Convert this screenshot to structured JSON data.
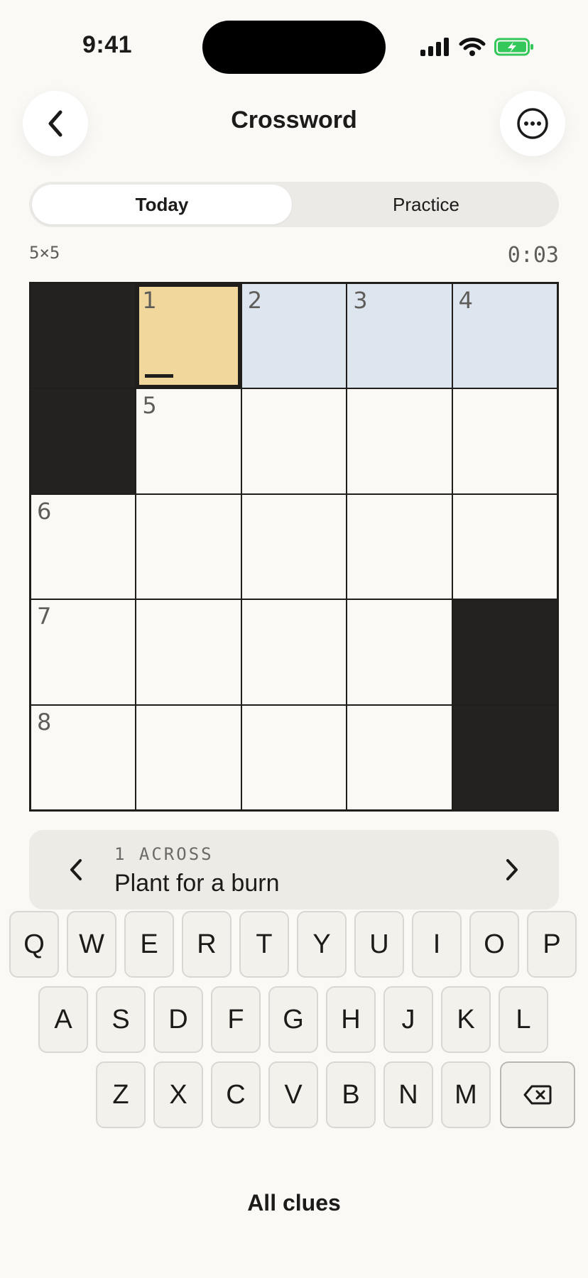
{
  "status": {
    "time": "9:41"
  },
  "header": {
    "title": "Crossword"
  },
  "tabs": [
    {
      "label": "Today",
      "active": true
    },
    {
      "label": "Practice",
      "active": false
    }
  ],
  "puzzle": {
    "size_label": "5×5",
    "timer": "0:03",
    "grid": [
      [
        "#",
        "1",
        "2",
        "3",
        "4"
      ],
      [
        "#",
        "5",
        "",
        "",
        ""
      ],
      [
        "6",
        "",
        "",
        "",
        ""
      ],
      [
        "7",
        "",
        "",
        "",
        "#"
      ],
      [
        "8",
        "",
        "",
        "",
        "#"
      ]
    ],
    "selected_cell": [
      0,
      1
    ],
    "active_word_cells": [
      [
        0,
        1
      ],
      [
        0,
        2
      ],
      [
        0,
        3
      ],
      [
        0,
        4
      ]
    ]
  },
  "clue": {
    "label": "1 ACROSS",
    "text": "Plant for a burn"
  },
  "keyboard": {
    "rows": [
      [
        "Q",
        "W",
        "E",
        "R",
        "T",
        "Y",
        "U",
        "I",
        "O",
        "P"
      ],
      [
        "A",
        "S",
        "D",
        "F",
        "G",
        "H",
        "J",
        "K",
        "L"
      ],
      [
        "Z",
        "X",
        "C",
        "V",
        "B",
        "N",
        "M"
      ]
    ],
    "backspace_icon": "backspace-icon"
  },
  "footer": {
    "all_clues_label": "All clues"
  },
  "colors": {
    "selected": "#f2d79c",
    "word_highlight": "#dde6ef",
    "block": "#232220",
    "battery": "#34c759"
  }
}
